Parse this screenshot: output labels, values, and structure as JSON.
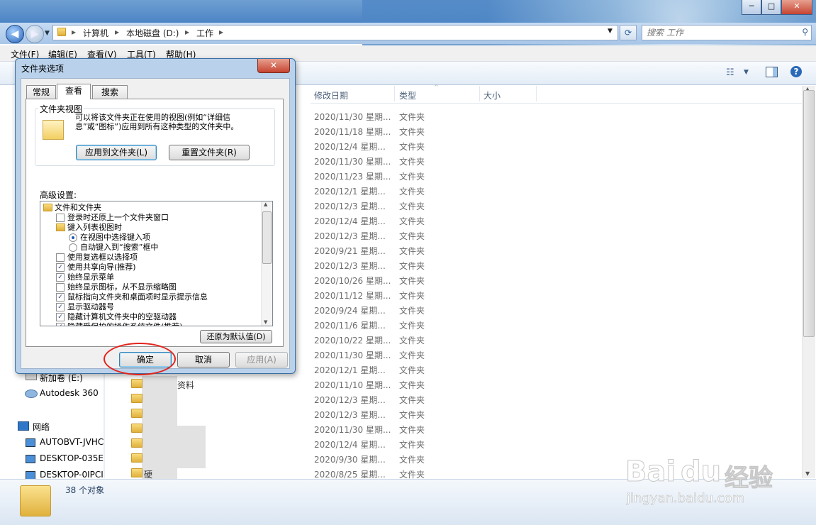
{
  "window": {
    "caption_buttons": [
      "─",
      "□",
      "✕"
    ]
  },
  "address": {
    "segments": [
      "计算机",
      "本地磁盘 (D:)",
      "工作"
    ],
    "separator": "▸"
  },
  "search": {
    "placeholder": "搜索 工作"
  },
  "menubar": [
    "文件(F)",
    "编辑(E)",
    "查看(V)",
    "工具(T)",
    "帮助(H)"
  ],
  "columns": {
    "date": "修改日期",
    "type": "类型",
    "size": "大小"
  },
  "rows": [
    {
      "date": "2020/11/30 星期...",
      "type": "文件夹"
    },
    {
      "date": "2020/11/18 星期...",
      "type": "文件夹"
    },
    {
      "date": "2020/12/4 星期...",
      "type": "文件夹"
    },
    {
      "date": "2020/11/30 星期...",
      "type": "文件夹"
    },
    {
      "date": "2020/11/23 星期...",
      "type": "文件夹"
    },
    {
      "date": "2020/12/1 星期...",
      "type": "文件夹"
    },
    {
      "date": "2020/12/3 星期...",
      "type": "文件夹"
    },
    {
      "date": "2020/12/4 星期...",
      "type": "文件夹"
    },
    {
      "date": "2020/12/3 星期...",
      "type": "文件夹"
    },
    {
      "date": "2020/9/21 星期...",
      "type": "文件夹"
    },
    {
      "date": "2020/12/3 星期...",
      "type": "文件夹"
    },
    {
      "date": "2020/10/26 星期...",
      "type": "文件夹"
    },
    {
      "date": "2020/11/12 星期...",
      "type": "文件夹"
    },
    {
      "date": "2020/9/24 星期...",
      "type": "文件夹"
    },
    {
      "date": "2020/11/6 星期...",
      "type": "文件夹"
    },
    {
      "date": "2020/10/22 星期...",
      "type": "文件夹"
    },
    {
      "date": "2020/11/30 星期...",
      "type": "文件夹"
    },
    {
      "date": "2020/12/1 星期...",
      "type": "文件夹"
    },
    {
      "date": "2020/11/10 星期...",
      "type": "文件夹"
    },
    {
      "date": "2020/12/3 星期...",
      "type": "文件夹"
    },
    {
      "date": "2020/12/3 星期...",
      "type": "文件夹"
    },
    {
      "date": "2020/11/30 星期...",
      "type": "文件夹"
    },
    {
      "date": "2020/12/4 星期...",
      "type": "文件夹"
    },
    {
      "date": "2020/9/30 星期...",
      "type": "文件夹"
    },
    {
      "date": "2020/8/25 星期...",
      "type": "文件夹"
    }
  ],
  "visible_names": {
    "row19": "资料",
    "row24": "硬"
  },
  "nav_pane": [
    {
      "label": "新加卷 (E:)",
      "icon": "drive-icon"
    },
    {
      "label": "Autodesk 360",
      "icon": "cloud-icon"
    },
    {
      "label": "网络",
      "icon": "network-icon"
    },
    {
      "label": "AUTOBVT-JVHC",
      "icon": "computer-icon"
    },
    {
      "label": "DESKTOP-035E",
      "icon": "computer-icon"
    },
    {
      "label": "DESKTOP-0IPCI",
      "icon": "computer-icon"
    }
  ],
  "status": {
    "count": "38 个对象"
  },
  "dialog": {
    "title": "文件夹选项",
    "close": "✕",
    "tabs": [
      "常规",
      "查看",
      "搜索"
    ],
    "group_label": "文件夹视图",
    "group_text": "可以将该文件夹正在使用的视图(例如“详细信息”或“图标”)应用到所有这种类型的文件夹中。",
    "apply_folders": "应用到文件夹(L)",
    "reset_folders": "重置文件夹(R)",
    "advanced_label": "高级设置:",
    "tree": [
      {
        "kind": "folder",
        "label": "文件和文件夹",
        "indent": 0
      },
      {
        "kind": "check",
        "checked": false,
        "label": "登录时还原上一个文件夹窗口",
        "indent": 1
      },
      {
        "kind": "folder",
        "label": "键入列表视图时",
        "indent": 1
      },
      {
        "kind": "radio",
        "checked": true,
        "label": "在视图中选择键入项",
        "indent": 2
      },
      {
        "kind": "radio",
        "checked": false,
        "label": "自动键入到“搜索”框中",
        "indent": 2
      },
      {
        "kind": "check",
        "checked": false,
        "label": "使用复选框以选择项",
        "indent": 1
      },
      {
        "kind": "check",
        "checked": true,
        "label": "使用共享向导(推荐)",
        "indent": 1
      },
      {
        "kind": "check",
        "checked": true,
        "label": "始终显示菜单",
        "indent": 1
      },
      {
        "kind": "check",
        "checked": false,
        "label": "始终显示图标，从不显示缩略图",
        "indent": 1
      },
      {
        "kind": "check",
        "checked": true,
        "label": "鼠标指向文件夹和桌面项时显示提示信息",
        "indent": 1
      },
      {
        "kind": "check",
        "checked": true,
        "label": "显示驱动器号",
        "indent": 1
      },
      {
        "kind": "check",
        "checked": true,
        "label": "隐藏计算机文件夹中的空驱动器",
        "indent": 1
      },
      {
        "kind": "check",
        "checked": true,
        "label": "隐藏受保护的操作系统文件(推荐)",
        "indent": 1
      }
    ],
    "restore_defaults": "还原为默认值(D)",
    "ok": "确定",
    "cancel": "取消",
    "apply": "应用(A)"
  },
  "watermark": {
    "brand": "Bai",
    "brand2": "du",
    "cn": "经验",
    "url": "jingyan.baidu.com"
  },
  "colors": {
    "accent": "#3a6ea5",
    "highlight_circle": "#e2231a",
    "titlebar": "#4c84c4"
  }
}
